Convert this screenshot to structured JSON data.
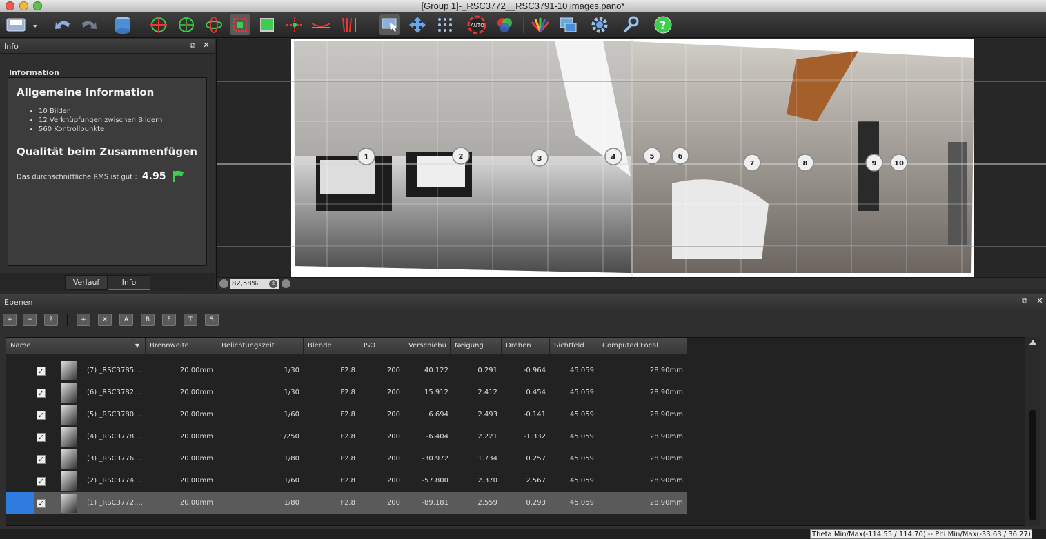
{
  "window": {
    "title": "[Group 1]-_RSC3772__RSC3791-10 images.pano*"
  },
  "toolbar": {
    "icons": [
      "save-dropdown-icon",
      "undo-icon",
      "redo-icon",
      "database-icon",
      "target-icon",
      "crosshair-icon",
      "rotate-icon",
      "crop-icon",
      "frame-icon",
      "center-icon",
      "horizon-icon",
      "vertical-lines-icon",
      "select-cursor-icon",
      "move-arrows-icon",
      "control-points-icon",
      "auto-color-icon",
      "rgb-icon",
      "color-fan-icon",
      "image-export-icon",
      "settings-gear-icon",
      "wrench-icon",
      "help-icon"
    ]
  },
  "info_panel": {
    "header": "Info",
    "section_label": "Information",
    "general_heading": "Allgemeine Information",
    "bullets": [
      "10 Bilder",
      "12 Verknüpfungen zwischen Bildern",
      "560 Kontrollpunkte"
    ],
    "quality_heading": "Qualität beim Zusammenfügen",
    "rms_text": "Das durchschnittliche RMS ist gut :",
    "rms_value": "4.95",
    "tabs": [
      "Verlauf",
      "Info"
    ],
    "active_tab": "Info"
  },
  "preview": {
    "zoom": "82,58%",
    "markers": [
      "1",
      "2",
      "3",
      "4",
      "5",
      "6",
      "7",
      "8",
      "9",
      "10"
    ]
  },
  "layers_panel": {
    "header": "Ebenen",
    "tools": [
      "add-image",
      "remove-image",
      "edit-image",
      "add-group",
      "delete-group",
      "A",
      "B",
      "F",
      "T",
      "S"
    ],
    "columns": [
      "Name",
      "Brennweite",
      "Belichtungszeit",
      "Blende",
      "ISO",
      "Verschiebu",
      "Neigung",
      "Drehen",
      "Sichtfeld",
      "Computed Focal"
    ],
    "rows": [
      {
        "name": "(7) _RSC3785....",
        "focal": "20.00mm",
        "exposure": "1/30",
        "aperture": "F2.8",
        "iso": "200",
        "shift": "40.122",
        "tilt": "0.291",
        "rotate": "-0.964",
        "fov": "45.059",
        "computed": "28.90mm"
      },
      {
        "name": "(6) _RSC3782....",
        "focal": "20.00mm",
        "exposure": "1/30",
        "aperture": "F2.8",
        "iso": "200",
        "shift": "15.912",
        "tilt": "2.412",
        "rotate": "0.454",
        "fov": "45.059",
        "computed": "28.90mm"
      },
      {
        "name": "(5) _RSC3780....",
        "focal": "20.00mm",
        "exposure": "1/60",
        "aperture": "F2.8",
        "iso": "200",
        "shift": "6.694",
        "tilt": "2.493",
        "rotate": "-0.141",
        "fov": "45.059",
        "computed": "28.90mm"
      },
      {
        "name": "(4) _RSC3778....",
        "focal": "20.00mm",
        "exposure": "1/250",
        "aperture": "F2.8",
        "iso": "200",
        "shift": "-6.404",
        "tilt": "2.221",
        "rotate": "-1.332",
        "fov": "45.059",
        "computed": "28.90mm"
      },
      {
        "name": "(3) _RSC3776....",
        "focal": "20.00mm",
        "exposure": "1/80",
        "aperture": "F2.8",
        "iso": "200",
        "shift": "-30.972",
        "tilt": "1.734",
        "rotate": "0.257",
        "fov": "45.059",
        "computed": "28.90mm"
      },
      {
        "name": "(2) _RSC3774....",
        "focal": "20.00mm",
        "exposure": "1/60",
        "aperture": "F2.8",
        "iso": "200",
        "shift": "-57.800",
        "tilt": "2.370",
        "rotate": "2.567",
        "fov": "45.059",
        "computed": "28.90mm"
      },
      {
        "name": "(1) _RSC3772....",
        "focal": "20.00mm",
        "exposure": "1/80",
        "aperture": "F2.8",
        "iso": "200",
        "shift": "-89.181",
        "tilt": "2.559",
        "rotate": "0.293",
        "fov": "45.059",
        "computed": "28.90mm",
        "selected": true
      }
    ]
  },
  "status": {
    "text": "Theta Min/Max(-114.55 / 114.70)  --  Phi Min/Max(-33.63 / 36.27)"
  }
}
